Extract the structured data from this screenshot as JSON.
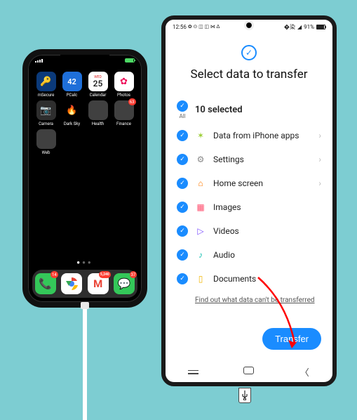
{
  "iphone": {
    "status": {
      "carrier_bars": 4,
      "wifi": true,
      "battery_pct": 90
    },
    "apps": [
      {
        "name": "mSecure",
        "bg": "#0b3a7a",
        "glyph": "🔑"
      },
      {
        "name": "PCalc",
        "bg": "#1e6fd9",
        "glyph": "42"
      },
      {
        "name": "Calendar",
        "bg": "#ffffff",
        "glyph": "25",
        "fg": "#111",
        "sub": "WED"
      },
      {
        "name": "Photos",
        "bg": "#ffffff",
        "glyph": "✿",
        "fg": "#e05"
      },
      {
        "name": "Camera",
        "bg": "#2e2e2e",
        "glyph": "📷"
      },
      {
        "name": "Dark Sky",
        "bg": "#000000",
        "glyph": "🔥"
      },
      {
        "name": "Health",
        "bg": "#000000",
        "folder": true
      },
      {
        "name": "Finance",
        "bg": "#000000",
        "folder": true,
        "badge": "63"
      },
      {
        "name": "Web",
        "bg": "#000000",
        "folder": true
      }
    ],
    "page_indicator": {
      "count": 3,
      "current": 1
    },
    "dock": [
      {
        "name": "Phone",
        "bg": "#34c759",
        "glyph": "✆",
        "badge": "14"
      },
      {
        "name": "Chrome",
        "bg": "#ffffff",
        "glyph": "◉"
      },
      {
        "name": "Gmail",
        "bg": "#ffffff",
        "glyph": "M",
        "badge": "5,240"
      },
      {
        "name": "Messages",
        "bg": "#34c759",
        "glyph": "✉",
        "badge": "37"
      }
    ]
  },
  "android": {
    "status": {
      "time": "12:56",
      "icons": "✿ ⊙ ◫ ◫ ⋈ ᐃ",
      "battery_text": "91%",
      "signal": true
    },
    "screen": {
      "header_icon": "check",
      "title": "Select data to transfer",
      "all_label": "All",
      "selected_summary": "10 selected",
      "items": [
        {
          "label": "Data from iPhone apps",
          "icon": "✶",
          "icon_color": "#9acd32",
          "chevron": true
        },
        {
          "label": "Settings",
          "icon": "⚙",
          "icon_color": "#888",
          "chevron": true
        },
        {
          "label": "Home screen",
          "icon": "⌂",
          "icon_color": "#ff7a00",
          "chevron": true
        },
        {
          "label": "Images",
          "icon": "▦",
          "icon_color": "#ff4d6d",
          "chevron": false
        },
        {
          "label": "Videos",
          "icon": "▷",
          "icon_color": "#7a4dff",
          "chevron": false
        },
        {
          "label": "Audio",
          "icon": "♪",
          "icon_color": "#17c1b3",
          "chevron": false
        },
        {
          "label": "Documents",
          "icon": "▯",
          "icon_color": "#f2b705",
          "chevron": false
        }
      ],
      "footnote": "Find out what data can't be transferred",
      "primary_button": "Transfer"
    },
    "nav": {
      "recent": "≡",
      "home": "□",
      "back": "<"
    }
  },
  "annotation": {
    "arrow_color": "#ff0000",
    "usb_glyph": "�ški"
  }
}
